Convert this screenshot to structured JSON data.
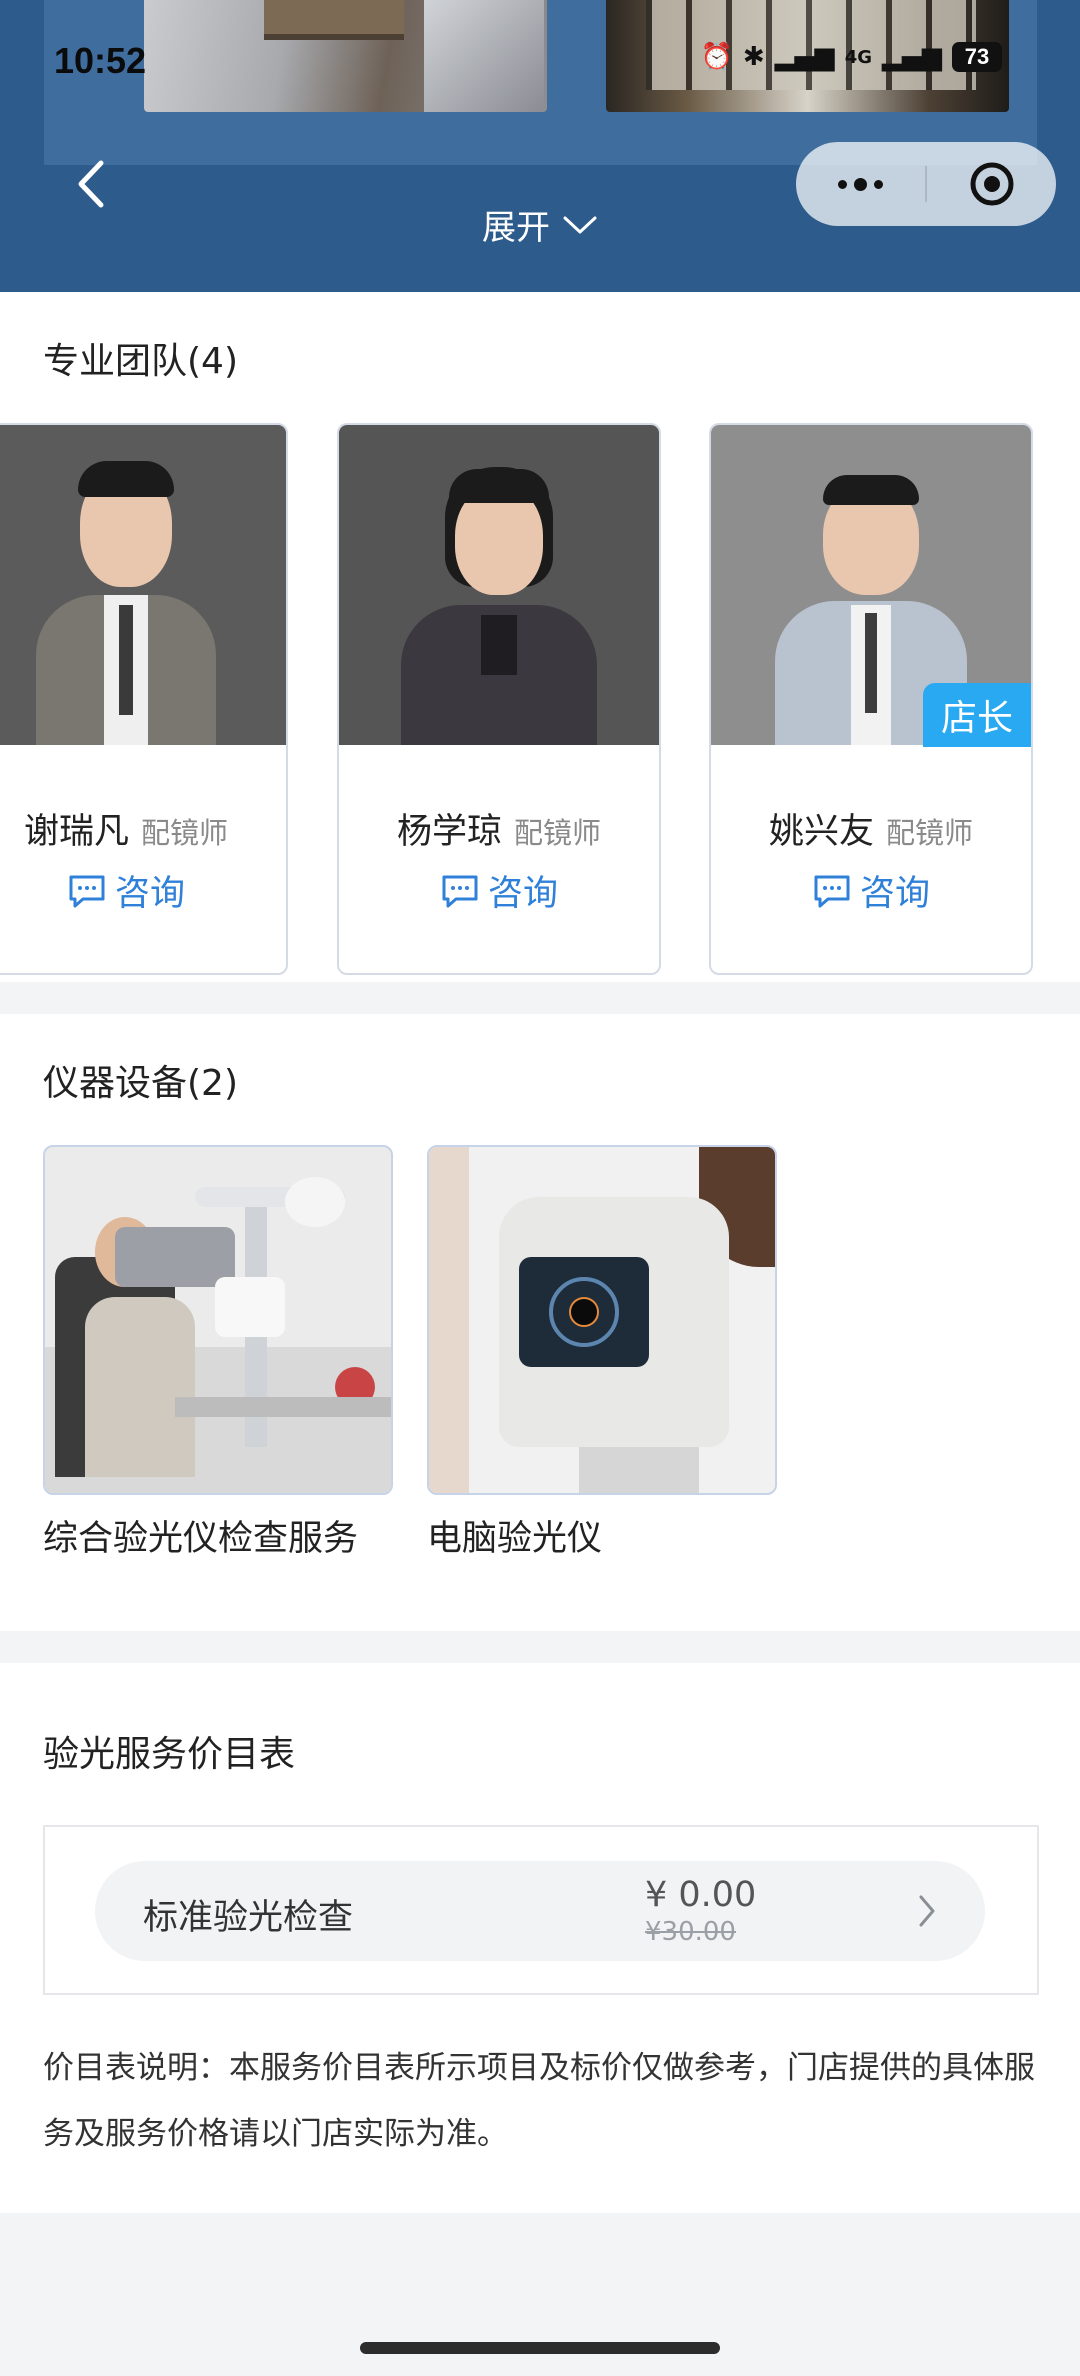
{
  "status_bar": {
    "time": "10:52",
    "battery": "73",
    "network": "4G"
  },
  "header": {
    "expand_label": "展开"
  },
  "team": {
    "title": "专业团队(4)",
    "members": [
      {
        "name": "谢瑞凡",
        "role": "配镜师",
        "consult": "咨询"
      },
      {
        "name": "杨学琼",
        "role": "配镜师",
        "consult": "咨询"
      },
      {
        "name": "姚兴友",
        "role": "配镜师",
        "consult": "咨询",
        "badge": "店长"
      }
    ]
  },
  "equipment": {
    "title": "仪器设备(2)",
    "items": [
      {
        "label": "综合验光仪检查服务"
      },
      {
        "label": "电脑验光仪"
      }
    ]
  },
  "price_list": {
    "title": "验光服务价目表",
    "rows": [
      {
        "name": "标准验光检查",
        "price": "¥ 0.00",
        "original_price": "¥30.00"
      }
    ],
    "note": "价目表说明：本服务价目表所示项目及标价仅做参考，门店提供的具体服务及服务价格请以门店实际为准。"
  },
  "colors": {
    "header_bg": "#2d5b8c",
    "accent": "#2f80d8",
    "badge": "#28a9f1"
  }
}
